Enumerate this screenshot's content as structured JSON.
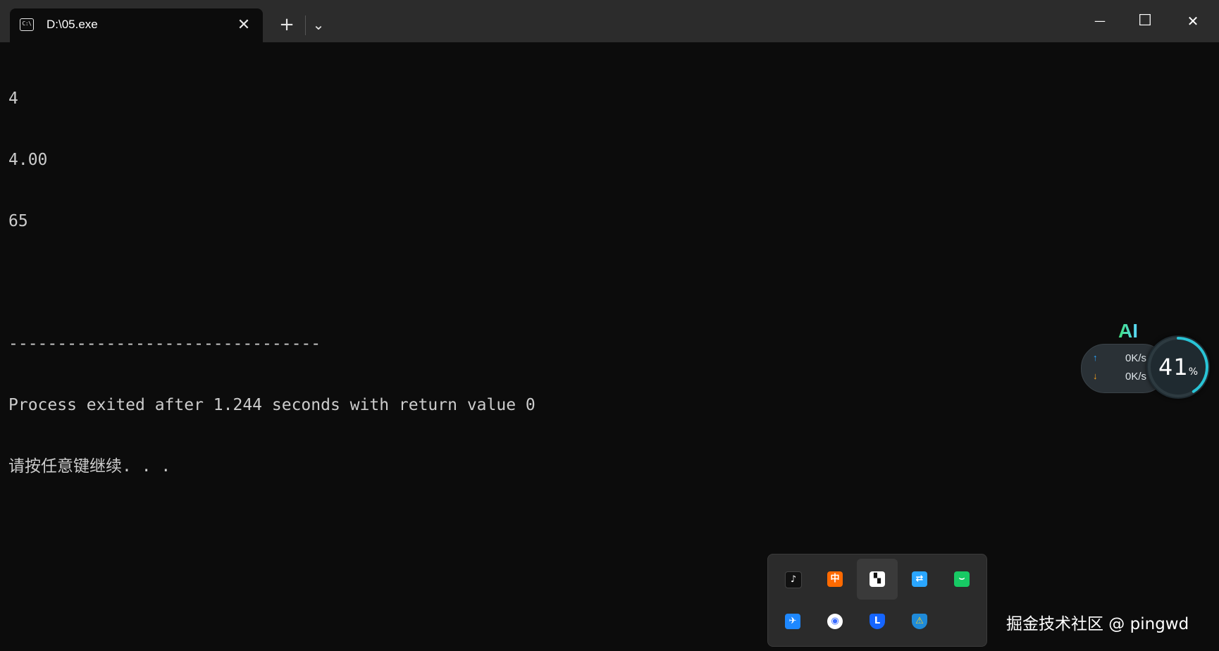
{
  "window": {
    "tab_title": "D:\\05.exe",
    "tab_icon_text": "C:\\",
    "close_tab_glyph": "✕",
    "new_tab_glyph": "+",
    "dropdown_glyph": "⌄",
    "minimize_glyph": "—",
    "maximize_glyph": "☐",
    "close_glyph": "✕"
  },
  "console": {
    "lines": [
      "4",
      "4.00",
      "65",
      "",
      "--------------------------------",
      "Process exited after 1.244 seconds with return value 0",
      "请按任意键继续. . ."
    ]
  },
  "network_widget": {
    "label": "AI",
    "upload": "0K/s",
    "download": "0K/s",
    "upload_arrow": "↑",
    "download_arrow": "↓",
    "percent": "41",
    "percent_unit": "%",
    "percent_value": 41,
    "ring_color": "#29c4d6",
    "upload_color": "#2aa6ff",
    "download_color": "#ffa41c"
  },
  "tray": {
    "icons": [
      {
        "name": "tiktok-icon",
        "glyph": "♪",
        "bg": "#111111"
      },
      {
        "name": "ime-chinese-icon",
        "glyph": "中",
        "bg": "#ff6a00"
      },
      {
        "name": "app-white-icon",
        "glyph": "▚",
        "bg": "#ffffff"
      },
      {
        "name": "link-app-icon",
        "glyph": "⇄",
        "bg": "#2aa6ff"
      },
      {
        "name": "wechat-store-icon",
        "glyph": "⌣",
        "bg": "#17c964"
      },
      {
        "name": "feishu-icon",
        "glyph": "✈",
        "bg": "#1e88ff"
      },
      {
        "name": "browser-swirl-icon",
        "glyph": "◉",
        "bg": "#ffffff"
      },
      {
        "name": "security-shield-icon",
        "glyph": "L",
        "bg": "#1565ff"
      },
      {
        "name": "defender-warning-icon",
        "glyph": "⚠",
        "bg": "#1f8ad8"
      }
    ]
  },
  "watermark": "掘金技术社区 @ pingwd"
}
